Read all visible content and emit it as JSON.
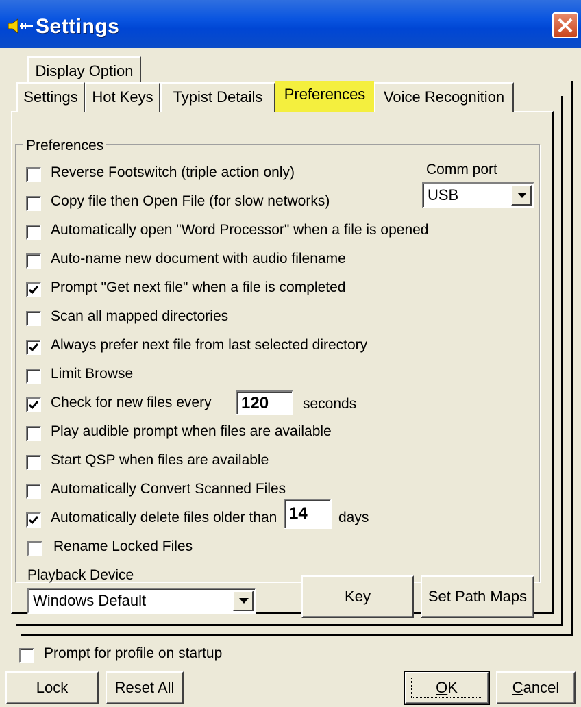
{
  "window": {
    "title": "Settings",
    "icon": "speaker-icon"
  },
  "tabs_back_row": [
    "Display Option"
  ],
  "tabs": [
    {
      "label": "Settings",
      "active": false
    },
    {
      "label": "Hot Keys",
      "active": false
    },
    {
      "label": "Typist Details",
      "active": false
    },
    {
      "label": "Preferences",
      "active": true
    },
    {
      "label": "Voice Recognition",
      "active": false
    }
  ],
  "preferences": {
    "group_label": "Preferences",
    "options": [
      {
        "label": "Reverse Footswitch (triple action only)",
        "checked": false
      },
      {
        "label": "Copy file then Open File (for slow networks)",
        "checked": false
      },
      {
        "label": "Automatically open \"Word Processor\"  when a file is opened",
        "checked": false
      },
      {
        "label": "Auto-name new document with audio filename",
        "checked": false
      },
      {
        "label": "Prompt \"Get next file\" when a file is completed",
        "checked": true
      },
      {
        "label": "Scan all mapped directories",
        "checked": false
      },
      {
        "label": "Always prefer next file from last selected directory",
        "checked": true
      },
      {
        "label": "Limit Browse",
        "checked": false
      },
      {
        "label": "Check for new files every",
        "checked": true
      },
      {
        "label": "Play audible prompt when files are available",
        "checked": false
      },
      {
        "label": "Start QSP when files are available",
        "checked": false
      },
      {
        "label": "Automatically Convert Scanned Files",
        "checked": false
      },
      {
        "label": "Automatically delete files older than",
        "checked": true
      },
      {
        "label": "Rename Locked Files",
        "checked": false
      }
    ],
    "check_interval": {
      "value": "120",
      "unit": "seconds"
    },
    "delete_age": {
      "value": "14",
      "unit": "days"
    },
    "comm_port": {
      "label": "Comm port",
      "value": "USB"
    },
    "playback_device": {
      "label": "Playback Device",
      "value": "Windows Default"
    },
    "key_button": "Key",
    "set_path_maps_button": "Set Path Maps"
  },
  "footer": {
    "prompt_profile_label": "Prompt for profile on startup",
    "prompt_profile_checked": false,
    "lock_button": "Lock",
    "reset_all_button": "Reset All",
    "ok_button": {
      "mnemonic": "O",
      "rest": "K"
    },
    "cancel_button": {
      "mnemonic": "C",
      "rest": "ancel"
    }
  }
}
